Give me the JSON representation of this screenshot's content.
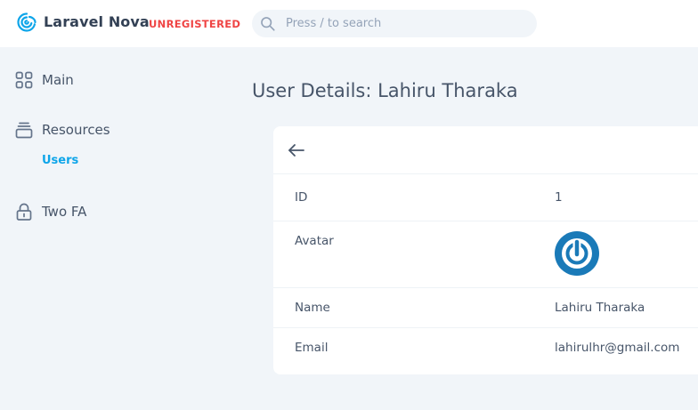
{
  "header": {
    "brand": "Laravel Nova",
    "unregistered": "UNREGISTERED",
    "search_placeholder": "Press / to search",
    "accent_color": "#0ea5e9"
  },
  "sidebar": {
    "items": [
      {
        "label": "Main",
        "icon": "grid-icon"
      },
      {
        "label": "Resources",
        "icon": "archive-icon",
        "children": [
          {
            "label": "Users",
            "active": true
          }
        ]
      },
      {
        "label": "Two FA",
        "icon": "lock-icon"
      }
    ]
  },
  "main": {
    "title": "User Details: Lahiru Tharaka",
    "fields": [
      {
        "label": "ID",
        "value": "1"
      },
      {
        "label": "Avatar",
        "value": ""
      },
      {
        "label": "Name",
        "value": "Lahiru Tharaka"
      },
      {
        "label": "Email",
        "value": "lahirulhr@gmail.com"
      }
    ]
  }
}
